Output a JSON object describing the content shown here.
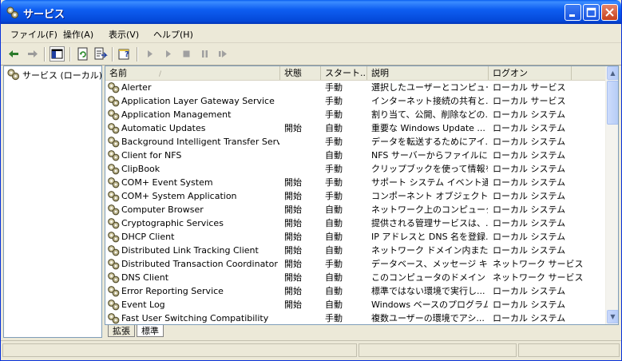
{
  "window": {
    "title": "サービス"
  },
  "menu": [
    "ファイル(F)",
    "操作(A)",
    "表示(V)",
    "ヘルプ(H)"
  ],
  "toolbar": {
    "icons": [
      "back-arrow-icon",
      "forward-arrow-icon",
      "show-hide-tree-icon",
      "refresh-icon",
      "export-list-icon",
      "help-properties-icon",
      "start-service-icon",
      "start-service-alt-icon",
      "stop-service-icon",
      "pause-service-icon",
      "restart-service-icon"
    ]
  },
  "tree": {
    "root_label": "サービス (ローカル)"
  },
  "table": {
    "columns": [
      "名前",
      "状態",
      "スタート...",
      "説明",
      "ログオン"
    ],
    "sort_arrow": "/",
    "rows": [
      {
        "name": "Alerter",
        "status": "",
        "startup": "手動",
        "description": "選択したユーザーとコンピュー...",
        "logon": "ローカル サービス"
      },
      {
        "name": "Application Layer Gateway Service",
        "status": "",
        "startup": "手動",
        "description": "インターネット接続の共有と...",
        "logon": "ローカル サービス"
      },
      {
        "name": "Application Management",
        "status": "",
        "startup": "手動",
        "description": "割り当て、公開、削除などの...",
        "logon": "ローカル システム"
      },
      {
        "name": "Automatic Updates",
        "status": "開始",
        "startup": "自動",
        "description": "重要な Windows Update ...",
        "logon": "ローカル システム"
      },
      {
        "name": "Background Intelligent Transfer Serv...",
        "status": "",
        "startup": "手動",
        "description": "データを転送するためにアイ...",
        "logon": "ローカル システム"
      },
      {
        "name": "Client for NFS",
        "status": "",
        "startup": "自動",
        "description": "NFS サーバーからファイルに...",
        "logon": "ローカル システム"
      },
      {
        "name": "ClipBook",
        "status": "",
        "startup": "手動",
        "description": "クリップブックを使って情報を...",
        "logon": "ローカル システム"
      },
      {
        "name": "COM+ Event System",
        "status": "開始",
        "startup": "手動",
        "description": "サポート システム イベント通...",
        "logon": "ローカル システム"
      },
      {
        "name": "COM+ System Application",
        "status": "開始",
        "startup": "手動",
        "description": "コンポーネント オブジェクト モ...",
        "logon": "ローカル システム"
      },
      {
        "name": "Computer Browser",
        "status": "開始",
        "startup": "自動",
        "description": "ネットワーク上のコンピュータ...",
        "logon": "ローカル システム"
      },
      {
        "name": "Cryptographic Services",
        "status": "開始",
        "startup": "自動",
        "description": "提供される管理サービスは、...",
        "logon": "ローカル システム"
      },
      {
        "name": "DHCP Client",
        "status": "開始",
        "startup": "自動",
        "description": "IP アドレスと DNS 名を登録...",
        "logon": "ローカル システム"
      },
      {
        "name": "Distributed Link Tracking Client",
        "status": "開始",
        "startup": "自動",
        "description": "ネットワーク ドメイン内または...",
        "logon": "ローカル システム"
      },
      {
        "name": "Distributed Transaction Coordinator",
        "status": "開始",
        "startup": "手動",
        "description": "データベース、メッセージ キュ...",
        "logon": "ネットワーク サービス"
      },
      {
        "name": "DNS Client",
        "status": "開始",
        "startup": "自動",
        "description": "このコンピュータのドメイン ネ...",
        "logon": "ネットワーク サービス"
      },
      {
        "name": "Error Reporting Service",
        "status": "開始",
        "startup": "自動",
        "description": "標準ではない環境で実行し...",
        "logon": "ローカル システム"
      },
      {
        "name": "Event Log",
        "status": "開始",
        "startup": "自動",
        "description": "Windows ベースのプログラム...",
        "logon": "ローカル システム"
      },
      {
        "name": "Fast User Switching Compatibility",
        "status": "",
        "startup": "手動",
        "description": "複数ユーザーの環境でアシ...",
        "logon": "ローカル システム"
      }
    ]
  },
  "tabs": [
    "拡張",
    "標準"
  ],
  "active_tab": "標準",
  "colors": {
    "titlebar": "#0a5ff0",
    "face": "#ece9d8",
    "border": "#7f9db9"
  }
}
